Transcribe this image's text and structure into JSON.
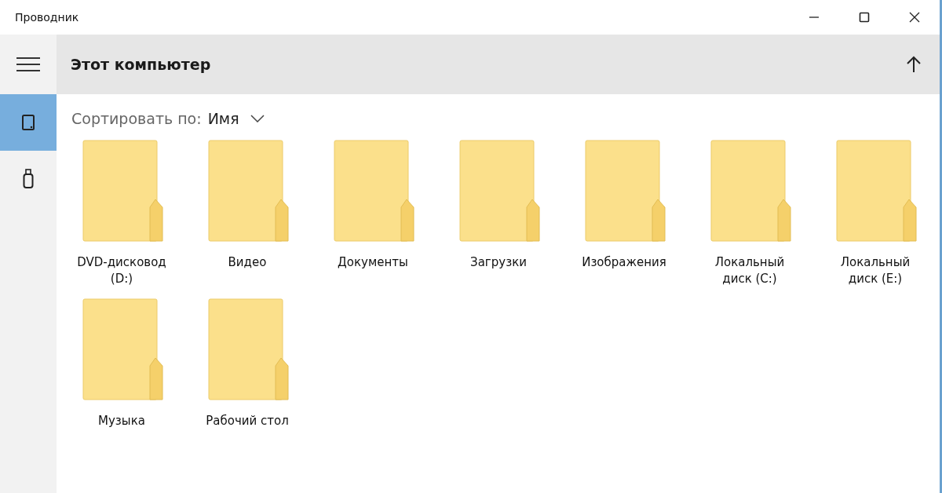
{
  "window": {
    "title": "Проводник"
  },
  "header": {
    "title": "Этот компьютер"
  },
  "sort": {
    "label": "Сортировать по:",
    "value": "Имя"
  },
  "sidebar": {
    "items": [
      {
        "kind": "computer",
        "selected": true
      },
      {
        "kind": "usb",
        "selected": false
      }
    ]
  },
  "items": [
    {
      "name": "DVD-дисковод (D:)"
    },
    {
      "name": "Видео"
    },
    {
      "name": "Документы"
    },
    {
      "name": "Загрузки"
    },
    {
      "name": "Изображения"
    },
    {
      "name": "Локальный диск (C:)"
    },
    {
      "name": "Локальный диск (E:)"
    },
    {
      "name": "Музыка"
    },
    {
      "name": "Рабочий стол"
    }
  ]
}
